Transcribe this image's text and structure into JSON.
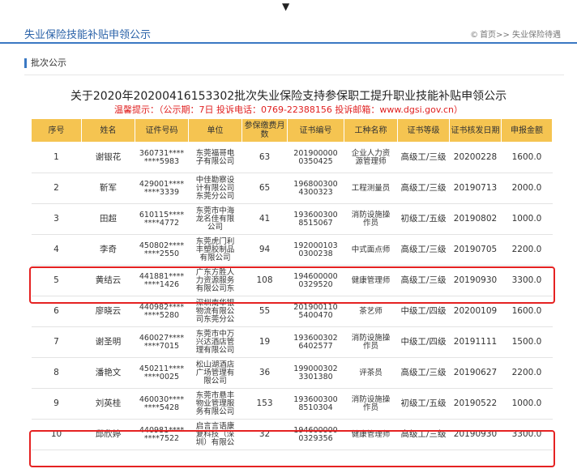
{
  "top_arrow": "▼",
  "header": {
    "title": "失业保险技能补贴申领公示"
  },
  "breadcrumb": {
    "home_icon": "©",
    "text": "首页>> 失业保险待遇"
  },
  "section": {
    "title": "批次公示"
  },
  "notice": {
    "title": "关于2020年20200416153302批次失业保险支持参保职工提升职业技能补贴申领公示",
    "hint": "温馨提示：（公示期：7日  投诉电话：0769-22388156  投诉邮箱：www.dgsi.gov.cn）"
  },
  "columns": [
    "序号",
    "姓名",
    "证件号码",
    "单位",
    "参保缴费月数",
    "证书编号",
    "工种名称",
    "证书等级",
    "证书核发日期",
    "申报金额"
  ],
  "rows": [
    {
      "no": "1",
      "name": "谢银花",
      "id": [
        "360731****",
        "****5983"
      ],
      "unit": [
        "东莞福哥电",
        "子有限公司"
      ],
      "months": "63",
      "cert": [
        "201900000",
        "0350425"
      ],
      "job": [
        "企业人力资",
        "源管理师"
      ],
      "level": "高级工/三级",
      "date": "20200228",
      "amount": "1600.0"
    },
    {
      "no": "2",
      "name": "靳军",
      "id": [
        "429001****",
        "****3339"
      ],
      "unit": [
        "中佳勘察设",
        "计有限公司",
        "东莞分公司"
      ],
      "months": "65",
      "cert": [
        "196800300",
        "4300323"
      ],
      "job": [
        "工程测量员"
      ],
      "level": "高级工/三级",
      "date": "20190713",
      "amount": "2000.0"
    },
    {
      "no": "3",
      "name": "田超",
      "id": [
        "610115****",
        "****4772"
      ],
      "unit": [
        "东莞市中海",
        "龙名佳有限",
        "公司"
      ],
      "months": "41",
      "cert": [
        "193600300",
        "8515067"
      ],
      "job": [
        "消防设施操",
        "作员"
      ],
      "level": "初级工/五级",
      "date": "20190802",
      "amount": "1000.0"
    },
    {
      "no": "4",
      "name": "李奇",
      "id": [
        "450802****",
        "****2550"
      ],
      "unit": [
        "东莞虎门利",
        "丰塑胶制品",
        "有限公司"
      ],
      "months": "94",
      "cert": [
        "192000103",
        "0300238"
      ],
      "job": [
        "中式面点师"
      ],
      "level": "高级工/三级",
      "date": "20190705",
      "amount": "2200.0"
    },
    {
      "no": "5",
      "name": "黄结云",
      "id": [
        "441881****",
        "****1426"
      ],
      "unit": [
        "广东方胜人",
        "力资源服务",
        "有限公司东"
      ],
      "months": "108",
      "cert": [
        "194600000",
        "0329520"
      ],
      "job": [
        "健康管理师"
      ],
      "level": "高级工/三级",
      "date": "20190930",
      "amount": "3300.0"
    },
    {
      "no": "6",
      "name": "廖晓云",
      "id": [
        "440982****",
        "****5280"
      ],
      "unit": [
        "深圳南华银",
        "物流有限公",
        "司东莞分公"
      ],
      "months": "55",
      "cert": [
        "201900110",
        "5400470"
      ],
      "job": [
        "茶艺师"
      ],
      "level": "中级工/四级",
      "date": "20200109",
      "amount": "1600.0"
    },
    {
      "no": "7",
      "name": "谢圣明",
      "id": [
        "460027****",
        "****7015"
      ],
      "unit": [
        "东莞市中万",
        "兴达酒店管",
        "理有限公司"
      ],
      "months": "19",
      "cert": [
        "193600302",
        "6402577"
      ],
      "job": [
        "消防设施操",
        "作员"
      ],
      "level": "中级工/四级",
      "date": "20191111",
      "amount": "1500.0"
    },
    {
      "no": "8",
      "name": "潘艳文",
      "id": [
        "450211****",
        "****0025"
      ],
      "unit": [
        "松山湖酒店",
        "广场管理有",
        "限公司"
      ],
      "months": "36",
      "cert": [
        "199000302",
        "3301380"
      ],
      "job": [
        "评茶员"
      ],
      "level": "高级工/三级",
      "date": "20190627",
      "amount": "2200.0"
    },
    {
      "no": "9",
      "name": "刘英桂",
      "id": [
        "460030****",
        "****5428"
      ],
      "unit": [
        "东莞市悬丰",
        "物业管理服",
        "务有限公司"
      ],
      "months": "153",
      "cert": [
        "193600300",
        "8510304"
      ],
      "job": [
        "消防设施操",
        "作员"
      ],
      "level": "初级工/五级",
      "date": "20190522",
      "amount": "1000.0"
    },
    {
      "no": "10",
      "name": "邱欣婷",
      "id": [
        "440981****",
        "****7522"
      ],
      "unit": [
        "启言言语康",
        "复科技（深",
        "圳）有限公"
      ],
      "months": "32",
      "cert": [
        "194600000",
        "0329356"
      ],
      "job": [
        "健康管理师"
      ],
      "level": "高级工/三级",
      "date": "20190930",
      "amount": "3300.0"
    }
  ],
  "highlight_color": "#e52222",
  "header_color": "#f5c451",
  "accent_color": "#3a78c3"
}
